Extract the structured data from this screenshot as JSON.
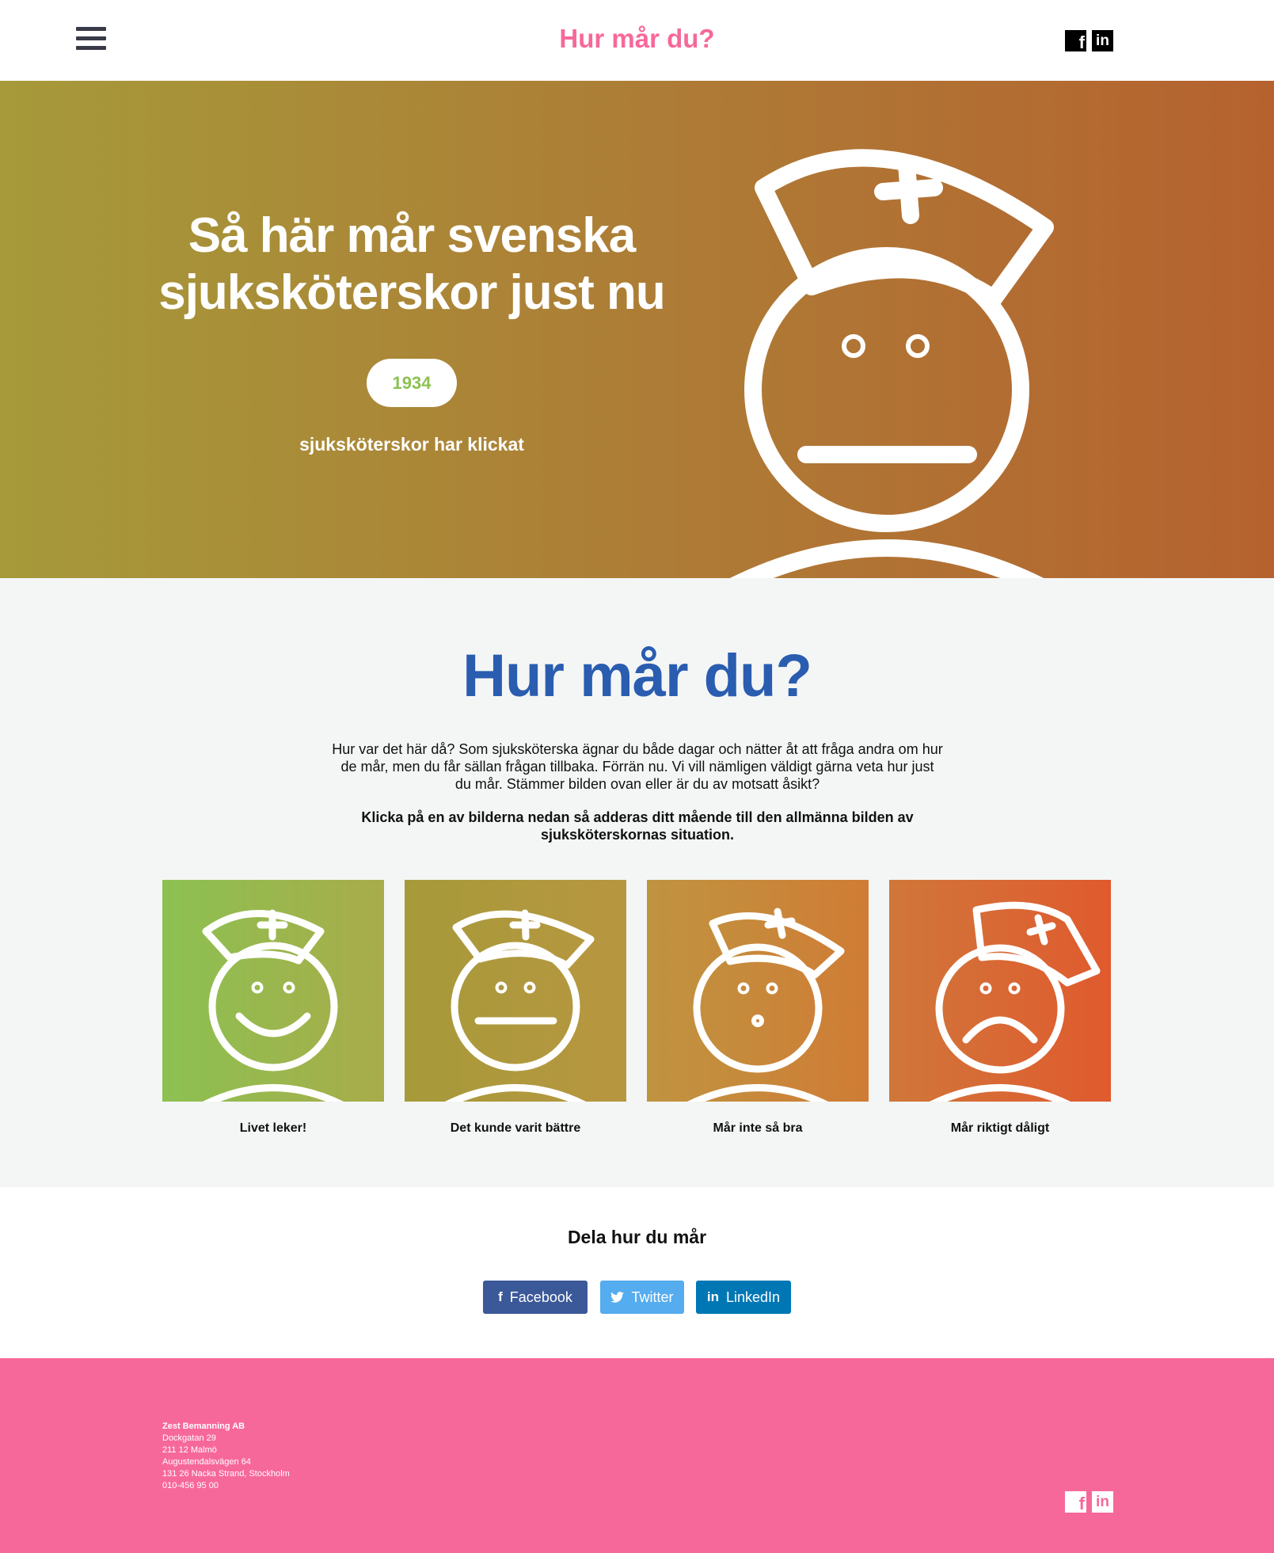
{
  "header": {
    "title": "Hur mår du?",
    "menu_icon": "hamburger-menu-icon",
    "social": [
      {
        "name": "facebook-icon",
        "glyph": "f"
      },
      {
        "name": "linkedin-icon",
        "glyph": "in"
      }
    ]
  },
  "hero": {
    "title": "Så här mår svenska sjuksköterskor just nu",
    "count": "1934",
    "count_caption": "sjuksköterskor har klickat",
    "figure": "neutral-nurse-face"
  },
  "mood": {
    "title": "Hur mår du?",
    "intro": "Hur var det här då? Som sjuksköterska ägnar du både dagar och nätter åt att fråga andra om hur de mår, men du får sällan frågan tillbaka. Förrän nu. Vi vill nämligen väldigt gärna veta hur just du mår. Stämmer bilden ovan eller är du av motsatt åsikt?",
    "cta": "Klicka på en av bilderna nedan så adderas ditt mående till den allmänna bilden av sjuksköterskornas situation.",
    "options": [
      {
        "label": "Livet leker!",
        "face": "happy",
        "color_from": "#8cc152",
        "color_to": "#a8ac4a"
      },
      {
        "label": "Det kunde varit bättre",
        "face": "neutral",
        "color_from": "#a69a3a",
        "color_to": "#b89640"
      },
      {
        "label": "Mår inte så bra",
        "face": "surprised",
        "color_from": "#bf9440",
        "color_to": "#d07c35"
      },
      {
        "label": "Mår riktigt dåligt",
        "face": "sad",
        "color_from": "#d0773a",
        "color_to": "#e05a2e"
      }
    ]
  },
  "share": {
    "title": "Dela hur du mår",
    "buttons": [
      {
        "label": "Facebook",
        "icon": "facebook-icon",
        "color": "#3b5998"
      },
      {
        "label": "Twitter",
        "icon": "twitter-bird-icon",
        "color": "#55acee"
      },
      {
        "label": "LinkedIn",
        "icon": "linkedin-icon",
        "color": "#0077b5"
      }
    ]
  },
  "footer": {
    "company": "Zest Bemanning AB",
    "address_lines": [
      "Dockgatan 29",
      "211 12 Malmö",
      "Augustendalsvägen 64",
      "131 26 Nacka Strand, Stockholm",
      "010-456 95 00"
    ],
    "background": "#f7689a"
  }
}
